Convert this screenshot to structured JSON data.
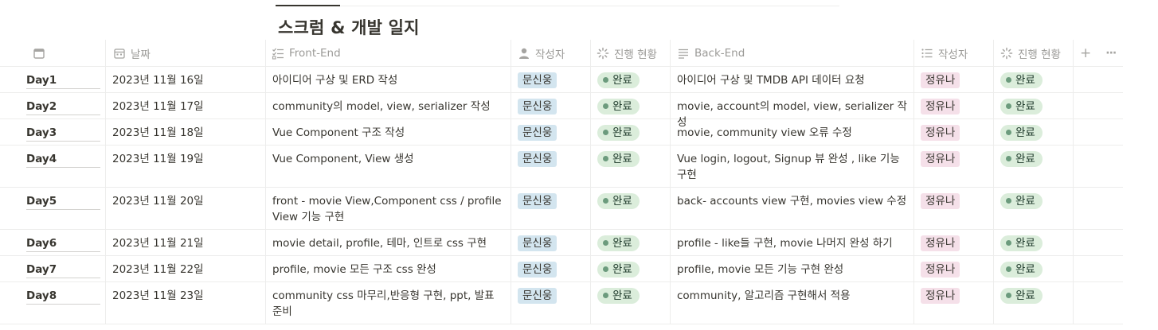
{
  "page": {
    "title": "스크럼 & 개발 일지"
  },
  "columns": [
    {
      "label": "",
      "icon": "calendar-icon"
    },
    {
      "label": "날짜",
      "icon": "calendar-icon"
    },
    {
      "label": "Front-End",
      "icon": "checklist-icon"
    },
    {
      "label": "작성자",
      "icon": "person-icon"
    },
    {
      "label": "진행 현황",
      "icon": "status-loader-icon"
    },
    {
      "label": "Back-End",
      "icon": "text-lines-icon"
    },
    {
      "label": "작성자",
      "icon": "list-icon"
    },
    {
      "label": "진행 현황",
      "icon": "status-loader-icon"
    }
  ],
  "toolbar": {
    "add_label": "+",
    "more_label": "···"
  },
  "colors": {
    "front_tag": "#d3e5ef",
    "back_tag": "#f5e0e9",
    "status_done": "#dbeddb"
  },
  "rows": [
    {
      "day": "Day1",
      "date": "2023년 11월 16일",
      "front": "아이디어 구상 및 ERD 작성",
      "front_author": "문신웅",
      "front_status": "완료",
      "back": "아이디어 구상 및 TMDB API 데이터 요청",
      "back_author": "정유나",
      "back_status": "완료"
    },
    {
      "day": "Day2",
      "date": "2023년 11월 17일",
      "front": "community의 model, view, serializer 작성",
      "front_author": "문신웅",
      "front_status": "완료",
      "back": "movie, account의 model, view, serializer 작성",
      "back_author": "정유나",
      "back_status": "완료"
    },
    {
      "day": "Day3",
      "date": "2023년 11월 18일",
      "front": "Vue Component 구조 작성",
      "front_author": "문신웅",
      "front_status": "완료",
      "back": "movie, community view 오류 수정",
      "back_author": "정유나",
      "back_status": "완료"
    },
    {
      "day": "Day4",
      "date": "2023년 11월 19일",
      "front": "Vue Component,  View 생성",
      "front_author": "문신웅",
      "front_status": "완료",
      "back": "Vue login, logout, Signup 뷰 완성 , like 기능 구현",
      "back_author": "정유나",
      "back_status": "완료"
    },
    {
      "day": "Day5",
      "date": "2023년 11월 20일",
      "front": "front - movie View,Component css / profile View 기능 구현",
      "front_author": "문신웅",
      "front_status": "완료",
      "back": "back- accounts view 구현, movies view 수정",
      "back_author": "정유나",
      "back_status": "완료"
    },
    {
      "day": "Day6",
      "date": "2023년 11월 21일",
      "front": " movie detail, profile, 테마, 인트로 css 구현",
      "front_author": "문신웅",
      "front_status": "완료",
      "back": "profile - like들 구현, movie 나머지 완성 하기",
      "back_author": "정유나",
      "back_status": "완료"
    },
    {
      "day": "Day7",
      "date": "2023년 11월 22일",
      "front": "profile, movie 모든 구조 css 완성",
      "front_author": "문신웅",
      "front_status": "완료",
      "back": "profile, movie 모든 기능 구현 완성",
      "back_author": "정유나",
      "back_status": "완료"
    },
    {
      "day": "Day8",
      "date": "2023년 11월 23일",
      "front": "community css 마무리,반응형 구현, ppt, 발표 준비",
      "front_author": "문신웅",
      "front_status": "완료",
      "back": "community, 알고리즘 구현해서 적용",
      "back_author": "정유나",
      "back_status": "완료"
    }
  ]
}
